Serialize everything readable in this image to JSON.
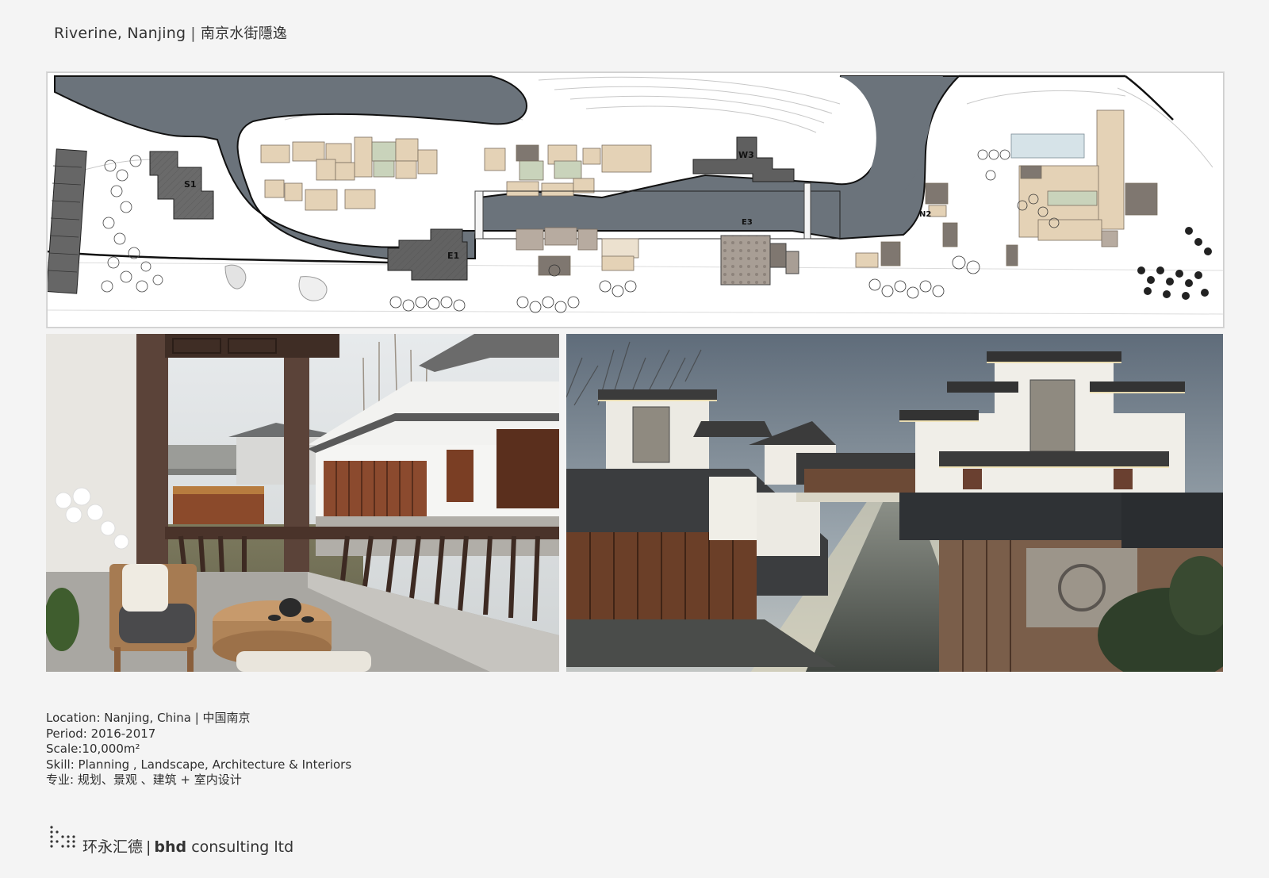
{
  "header": {
    "title": "Riverine, Nanjing",
    "separator": "|",
    "subtitle_cn": "南京水街隱逸"
  },
  "plan": {
    "labels": {
      "s1": "S1",
      "w3": "W3",
      "e1": "E1",
      "e3": "E3",
      "n2": "N2"
    },
    "colors": {
      "water": "#6b737b",
      "tan": "#e4d2b6",
      "sage": "#c9d3bb",
      "dark_roof": "#5f5f5f",
      "taupe": "#b7aba0"
    }
  },
  "details": {
    "location": "Location: Nanjing, China | 中国南京",
    "period": "Period: 2016-2017",
    "scale": "Scale:10,000m²",
    "skill": "Skill: Planning , Landscape, Architecture & Interiors",
    "skill_cn": "专业: 规划、景观 、建筑 + 室内设计"
  },
  "footer": {
    "company_cn": "环永汇德",
    "separator": "|",
    "brand_bold": "bhd",
    "brand_rest": " consulting ltd"
  }
}
